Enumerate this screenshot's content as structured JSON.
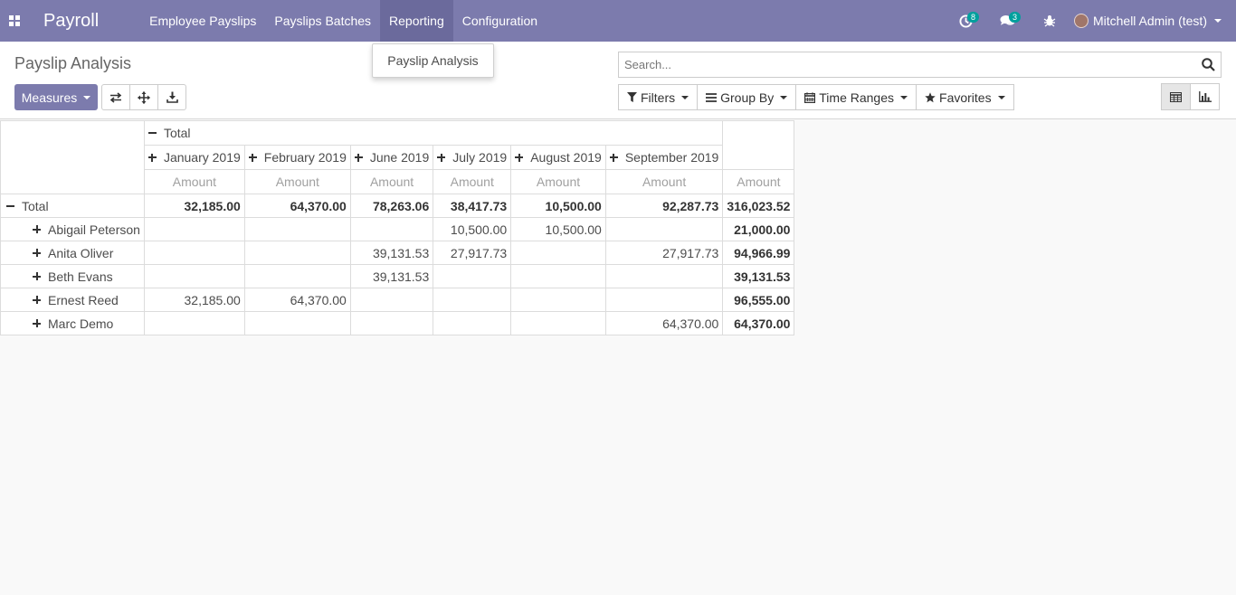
{
  "app": {
    "title": "Payroll",
    "menu": [
      "Employee Payslips",
      "Payslips Batches",
      "Reporting",
      "Configuration"
    ],
    "activity_badge": "8",
    "messages_badge": "3",
    "user": "Mitchell Admin (test)",
    "accent": "#7c7bad"
  },
  "dropdown": {
    "item": "Payslip Analysis"
  },
  "control": {
    "title": "Payslip Analysis",
    "measures_label": "Measures",
    "search_placeholder": "Search...",
    "filters_label": "Filters",
    "groupby_label": "Group By",
    "timeranges_label": "Time Ranges",
    "favorites_label": "Favorites"
  },
  "pivot": {
    "total_label": "Total",
    "measure": "Amount",
    "columns": [
      "January 2019",
      "February 2019",
      "June 2019",
      "July 2019",
      "August 2019",
      "September 2019"
    ],
    "total_row": {
      "label": "Total",
      "values": [
        "32,185.00",
        "64,370.00",
        "78,263.06",
        "38,417.73",
        "10,500.00",
        "92,287.73"
      ],
      "total": "316,023.52"
    },
    "rows": [
      {
        "label": "Abigail Peterson",
        "values": [
          "",
          "",
          "",
          "10,500.00",
          "10,500.00",
          ""
        ],
        "total": "21,000.00"
      },
      {
        "label": "Anita Oliver",
        "values": [
          "",
          "",
          "39,131.53",
          "27,917.73",
          "",
          "27,917.73"
        ],
        "total": "94,966.99"
      },
      {
        "label": "Beth Evans",
        "values": [
          "",
          "",
          "39,131.53",
          "",
          "",
          ""
        ],
        "total": "39,131.53"
      },
      {
        "label": "Ernest Reed",
        "values": [
          "32,185.00",
          "64,370.00",
          "",
          "",
          "",
          ""
        ],
        "total": "96,555.00"
      },
      {
        "label": "Marc Demo",
        "values": [
          "",
          "",
          "",
          "",
          "",
          "64,370.00"
        ],
        "total": "64,370.00"
      }
    ]
  }
}
